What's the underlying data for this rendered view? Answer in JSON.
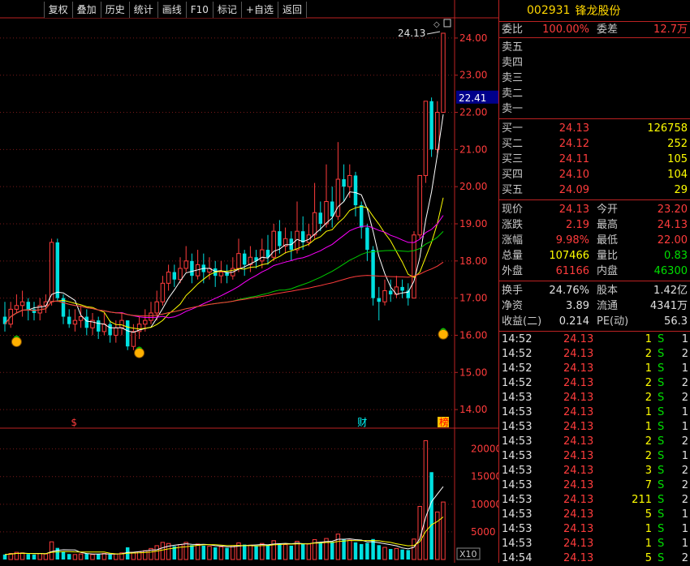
{
  "toolbar": [
    "复权",
    "叠加",
    "历史",
    "统计",
    "画线",
    "F10",
    "标记",
    "+自选",
    "返回"
  ],
  "stock": {
    "code": "002931",
    "name": "锋龙股份"
  },
  "order_ratio": {
    "label1": "委比",
    "val1": "100.00%",
    "label2": "委差",
    "val2": "12.7万"
  },
  "sell_levels": [
    "卖五",
    "卖四",
    "卖三",
    "卖二",
    "卖一"
  ],
  "buy_levels": [
    {
      "label": "买一",
      "price": "24.13",
      "vol": "126758"
    },
    {
      "label": "买二",
      "price": "24.12",
      "vol": "252"
    },
    {
      "label": "买三",
      "price": "24.11",
      "vol": "105"
    },
    {
      "label": "买四",
      "price": "24.10",
      "vol": "104"
    },
    {
      "label": "买五",
      "price": "24.09",
      "vol": "29"
    }
  ],
  "quote": [
    {
      "l1": "现价",
      "v1": "24.13",
      "c1": "red",
      "l2": "今开",
      "v2": "23.20",
      "c2": "red"
    },
    {
      "l1": "涨跌",
      "v1": "2.19",
      "c1": "red",
      "l2": "最高",
      "v2": "24.13",
      "c2": "red"
    },
    {
      "l1": "涨幅",
      "v1": "9.98%",
      "c1": "red",
      "l2": "最低",
      "v2": "22.00",
      "c2": "red"
    },
    {
      "l1": "总量",
      "v1": "107466",
      "c1": "yellow",
      "l2": "量比",
      "v2": "0.83",
      "c2": "green"
    },
    {
      "l1": "外盘",
      "v1": "61166",
      "c1": "red",
      "l2": "内盘",
      "v2": "46300",
      "c2": "green"
    }
  ],
  "fundamentals": [
    {
      "l1": "换手",
      "v1": "24.76%",
      "l2": "股本",
      "v2": "1.42亿"
    },
    {
      "l1": "净资",
      "v1": "3.89",
      "l2": "流通",
      "v2": "4341万"
    },
    {
      "l1": "收益(二)",
      "v1": "0.214",
      "l2": "PE(动)",
      "v2": "56.3"
    }
  ],
  "ticks": [
    {
      "t": "14:52",
      "p": "24.13",
      "v": "1",
      "s": "S",
      "n": "1"
    },
    {
      "t": "14:52",
      "p": "24.13",
      "v": "2",
      "s": "S",
      "n": "2"
    },
    {
      "t": "14:52",
      "p": "24.13",
      "v": "1",
      "s": "S",
      "n": "1"
    },
    {
      "t": "14:52",
      "p": "24.13",
      "v": "2",
      "s": "S",
      "n": "2"
    },
    {
      "t": "14:53",
      "p": "24.13",
      "v": "2",
      "s": "S",
      "n": "2"
    },
    {
      "t": "14:53",
      "p": "24.13",
      "v": "1",
      "s": "S",
      "n": "1"
    },
    {
      "t": "14:53",
      "p": "24.13",
      "v": "1",
      "s": "S",
      "n": "1"
    },
    {
      "t": "14:53",
      "p": "24.13",
      "v": "2",
      "s": "S",
      "n": "2"
    },
    {
      "t": "14:53",
      "p": "24.13",
      "v": "2",
      "s": "S",
      "n": "1"
    },
    {
      "t": "14:53",
      "p": "24.13",
      "v": "3",
      "s": "S",
      "n": "2"
    },
    {
      "t": "14:53",
      "p": "24.13",
      "v": "7",
      "s": "S",
      "n": "2"
    },
    {
      "t": "14:53",
      "p": "24.13",
      "v": "211",
      "s": "S",
      "n": "2"
    },
    {
      "t": "14:53",
      "p": "24.13",
      "v": "5",
      "s": "S",
      "n": "1"
    },
    {
      "t": "14:53",
      "p": "24.13",
      "v": "1",
      "s": "S",
      "n": "1"
    },
    {
      "t": "14:53",
      "p": "24.13",
      "v": "1",
      "s": "S",
      "n": "1"
    },
    {
      "t": "14:54",
      "p": "24.13",
      "v": "5",
      "s": "S",
      "n": "2"
    }
  ],
  "chart_data": {
    "type": "candlestick",
    "price_axis": {
      "ticks": [
        "24.00",
        "23.00",
        "22.00",
        "21.00",
        "20.00",
        "19.00",
        "18.00",
        "17.00",
        "16.00",
        "15.00",
        "14.00"
      ],
      "ylim": [
        13.5,
        24.5
      ]
    },
    "current_price_tag": "22.41",
    "high_label": "24.13",
    "volume_axis": {
      "ticks": [
        "20000",
        "15000",
        "10000",
        "5000"
      ],
      "unit": "X10",
      "ylim": [
        0,
        22000
      ]
    },
    "markers": [
      "$",
      "财",
      "榜"
    ],
    "colors": {
      "up": "#ff3c3c",
      "down": "#00e0e0",
      "ma5": "#ffffff",
      "ma10": "#ffff00",
      "ma20": "#ff00ff",
      "ma60": "#00cc00",
      "ma120": "#ff3c3c"
    },
    "candles": [
      [
        16.5,
        16.3,
        16.9,
        16.1
      ],
      [
        16.3,
        16.7,
        16.9,
        16.2
      ],
      [
        16.7,
        16.8,
        17.1,
        16.6
      ],
      [
        16.8,
        16.9,
        17.2,
        16.5
      ],
      [
        16.9,
        16.7,
        17.0,
        16.4
      ],
      [
        16.7,
        16.6,
        16.9,
        16.4
      ],
      [
        16.6,
        16.8,
        17.0,
        16.4
      ],
      [
        16.8,
        16.9,
        17.1,
        16.6
      ],
      [
        16.9,
        18.5,
        18.6,
        16.8
      ],
      [
        18.5,
        17.0,
        18.6,
        16.9
      ],
      [
        17.0,
        16.5,
        17.1,
        16.3
      ],
      [
        16.5,
        16.3,
        16.7,
        16.2
      ],
      [
        16.3,
        16.4,
        16.7,
        16.1
      ],
      [
        16.4,
        16.5,
        16.8,
        16.2
      ],
      [
        16.5,
        16.2,
        16.7,
        16.0
      ],
      [
        16.2,
        16.4,
        16.6,
        16.0
      ],
      [
        16.4,
        16.1,
        16.5,
        15.9
      ],
      [
        16.1,
        16.3,
        16.6,
        16.0
      ],
      [
        16.3,
        16.0,
        16.4,
        15.8
      ],
      [
        16.0,
        16.2,
        16.4,
        15.8
      ],
      [
        16.2,
        16.4,
        16.6,
        16.0
      ],
      [
        16.4,
        15.7,
        16.4,
        15.6
      ],
      [
        15.7,
        16.1,
        16.3,
        15.6
      ],
      [
        16.1,
        16.3,
        16.5,
        15.9
      ],
      [
        16.3,
        16.4,
        16.7,
        16.1
      ],
      [
        16.4,
        16.6,
        16.9,
        16.3
      ],
      [
        16.6,
        16.9,
        17.2,
        16.4
      ],
      [
        16.9,
        17.4,
        17.6,
        16.8
      ],
      [
        17.4,
        17.7,
        17.9,
        17.2
      ],
      [
        17.7,
        17.5,
        17.9,
        17.3
      ],
      [
        17.5,
        17.8,
        18.1,
        17.4
      ],
      [
        17.8,
        18.0,
        18.4,
        17.7
      ],
      [
        18.0,
        17.6,
        18.2,
        17.4
      ],
      [
        17.6,
        17.9,
        18.3,
        17.5
      ],
      [
        17.9,
        17.7,
        18.2,
        17.4
      ],
      [
        17.7,
        17.8,
        18.1,
        17.5
      ],
      [
        17.8,
        17.6,
        18.0,
        17.3
      ],
      [
        17.6,
        17.7,
        18.0,
        17.4
      ],
      [
        17.7,
        17.6,
        17.9,
        17.4
      ],
      [
        17.6,
        17.8,
        18.1,
        17.5
      ],
      [
        17.8,
        18.2,
        18.6,
        17.7
      ],
      [
        18.2,
        17.9,
        18.3,
        17.6
      ],
      [
        17.9,
        18.1,
        18.4,
        17.7
      ],
      [
        18.1,
        18.0,
        18.3,
        17.8
      ],
      [
        18.0,
        18.3,
        18.6,
        17.8
      ],
      [
        18.3,
        18.1,
        18.7,
        17.9
      ],
      [
        18.1,
        18.8,
        19.0,
        18.0
      ],
      [
        18.8,
        18.4,
        19.1,
        18.2
      ],
      [
        18.4,
        18.6,
        18.9,
        18.2
      ],
      [
        18.6,
        18.3,
        18.8,
        18.0
      ],
      [
        18.3,
        18.8,
        19.6,
        18.2
      ],
      [
        18.8,
        18.5,
        19.2,
        18.3
      ],
      [
        18.5,
        18.7,
        19.0,
        18.4
      ],
      [
        18.7,
        19.3,
        20.1,
        18.6
      ],
      [
        19.3,
        19.0,
        19.6,
        18.8
      ],
      [
        19.0,
        19.6,
        20.6,
        18.9
      ],
      [
        19.6,
        19.2,
        20.0,
        18.9
      ],
      [
        19.2,
        20.2,
        21.2,
        19.1
      ],
      [
        20.2,
        20.0,
        20.6,
        19.6
      ],
      [
        20.0,
        20.3,
        20.6,
        19.7
      ],
      [
        20.3,
        19.5,
        20.4,
        19.2
      ],
      [
        19.5,
        18.9,
        19.6,
        18.6
      ],
      [
        18.9,
        18.3,
        19.0,
        18.0
      ],
      [
        18.3,
        17.0,
        18.4,
        16.8
      ],
      [
        17.0,
        16.9,
        17.3,
        16.4
      ],
      [
        16.9,
        17.2,
        17.5,
        16.8
      ],
      [
        17.2,
        17.1,
        17.5,
        16.9
      ],
      [
        17.1,
        17.3,
        17.6,
        17.0
      ],
      [
        17.3,
        17.2,
        17.5,
        17.0
      ],
      [
        17.2,
        17.0,
        17.4,
        16.8
      ],
      [
        17.0,
        18.7,
        18.8,
        17.0
      ],
      [
        18.7,
        20.3,
        20.3,
        18.6
      ],
      [
        20.3,
        22.3,
        22.3,
        20.1
      ],
      [
        22.3,
        21.0,
        22.4,
        20.8
      ],
      [
        21.0,
        22.0,
        22.3,
        20.9
      ],
      [
        22.0,
        24.13,
        24.13,
        22.0
      ]
    ],
    "volumes": [
      900,
      1100,
      1300,
      1200,
      1000,
      900,
      1100,
      1000,
      3200,
      2100,
      1400,
      1000,
      900,
      1000,
      1100,
      900,
      1000,
      1100,
      900,
      1000,
      1200,
      2200,
      1300,
      1400,
      1600,
      2000,
      2500,
      3100,
      2900,
      2400,
      2700,
      3100,
      2600,
      2800,
      2500,
      2400,
      2200,
      2300,
      2100,
      2500,
      3000,
      2700,
      2600,
      2400,
      2900,
      2700,
      3400,
      2900,
      2700,
      2500,
      3300,
      2900,
      2800,
      3600,
      3100,
      3800,
      3200,
      4600,
      3600,
      3500,
      3100,
      2800,
      3000,
      3700,
      2600,
      2200,
      1900,
      2000,
      1800,
      1700,
      3700,
      9600,
      21500,
      15800,
      8600,
      10400
    ]
  }
}
